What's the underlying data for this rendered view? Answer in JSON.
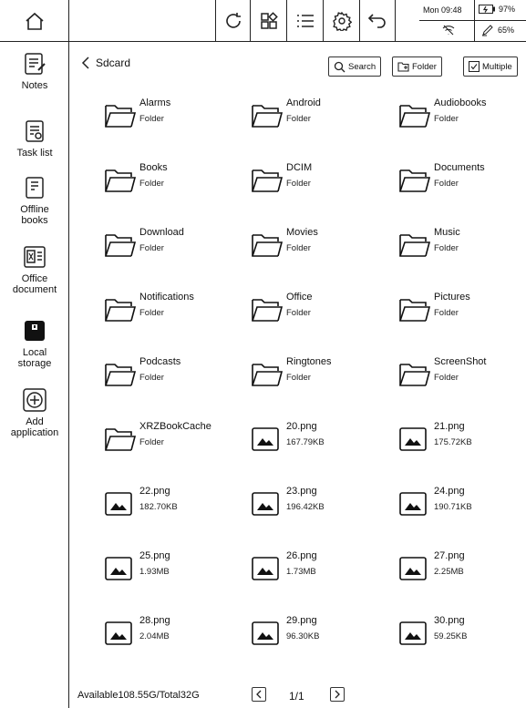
{
  "status": {
    "time": "Mon 09:48",
    "battery": "97%",
    "pen_battery": "65%"
  },
  "sidebar": {
    "items": [
      {
        "label": "Notes",
        "icon": "notes-icon"
      },
      {
        "label": "Task list",
        "icon": "task-list-icon"
      },
      {
        "label": "Offline books",
        "icon": "offline-books-icon"
      },
      {
        "label": "Office document",
        "icon": "office-document-icon"
      },
      {
        "label": "Local storage",
        "icon": "local-storage-icon"
      },
      {
        "label": "Add application",
        "icon": "add-application-icon"
      }
    ]
  },
  "main": {
    "breadcrumb": "Sdcard",
    "search_label": "Search",
    "folder_label": "Folder",
    "multiple_label": "Multiple"
  },
  "files": [
    {
      "name": "Alarms",
      "meta": "Folder",
      "type": "folder"
    },
    {
      "name": "Android",
      "meta": "Folder",
      "type": "folder"
    },
    {
      "name": "Audiobooks",
      "meta": "Folder",
      "type": "folder"
    },
    {
      "name": "Books",
      "meta": "Folder",
      "type": "folder"
    },
    {
      "name": "DCIM",
      "meta": "Folder",
      "type": "folder"
    },
    {
      "name": "Documents",
      "meta": "Folder",
      "type": "folder"
    },
    {
      "name": "Download",
      "meta": "Folder",
      "type": "folder"
    },
    {
      "name": "Movies",
      "meta": "Folder",
      "type": "folder"
    },
    {
      "name": "Music",
      "meta": "Folder",
      "type": "folder"
    },
    {
      "name": "Notifications",
      "meta": "Folder",
      "type": "folder"
    },
    {
      "name": "Office",
      "meta": "Folder",
      "type": "folder"
    },
    {
      "name": "Pictures",
      "meta": "Folder",
      "type": "folder"
    },
    {
      "name": "Podcasts",
      "meta": "Folder",
      "type": "folder"
    },
    {
      "name": "Ringtones",
      "meta": "Folder",
      "type": "folder"
    },
    {
      "name": "ScreenShot",
      "meta": "Folder",
      "type": "folder"
    },
    {
      "name": "XRZBookCache",
      "meta": "Folder",
      "type": "folder"
    },
    {
      "name": "20.png",
      "meta": "167.79KB",
      "type": "image"
    },
    {
      "name": "21.png",
      "meta": "175.72KB",
      "type": "image"
    },
    {
      "name": "22.png",
      "meta": "182.70KB",
      "type": "image"
    },
    {
      "name": "23.png",
      "meta": "196.42KB",
      "type": "image"
    },
    {
      "name": "24.png",
      "meta": "190.71KB",
      "type": "image"
    },
    {
      "name": "25.png",
      "meta": "1.93MB",
      "type": "image"
    },
    {
      "name": "26.png",
      "meta": "1.73MB",
      "type": "image"
    },
    {
      "name": "27.png",
      "meta": "2.25MB",
      "type": "image"
    },
    {
      "name": "28.png",
      "meta": "2.04MB",
      "type": "image"
    },
    {
      "name": "29.png",
      "meta": "96.30KB",
      "type": "image"
    },
    {
      "name": "30.png",
      "meta": "59.25KB",
      "type": "image"
    }
  ],
  "footer": {
    "storage": "Available108.55G/Total32G",
    "page": "1/1"
  }
}
